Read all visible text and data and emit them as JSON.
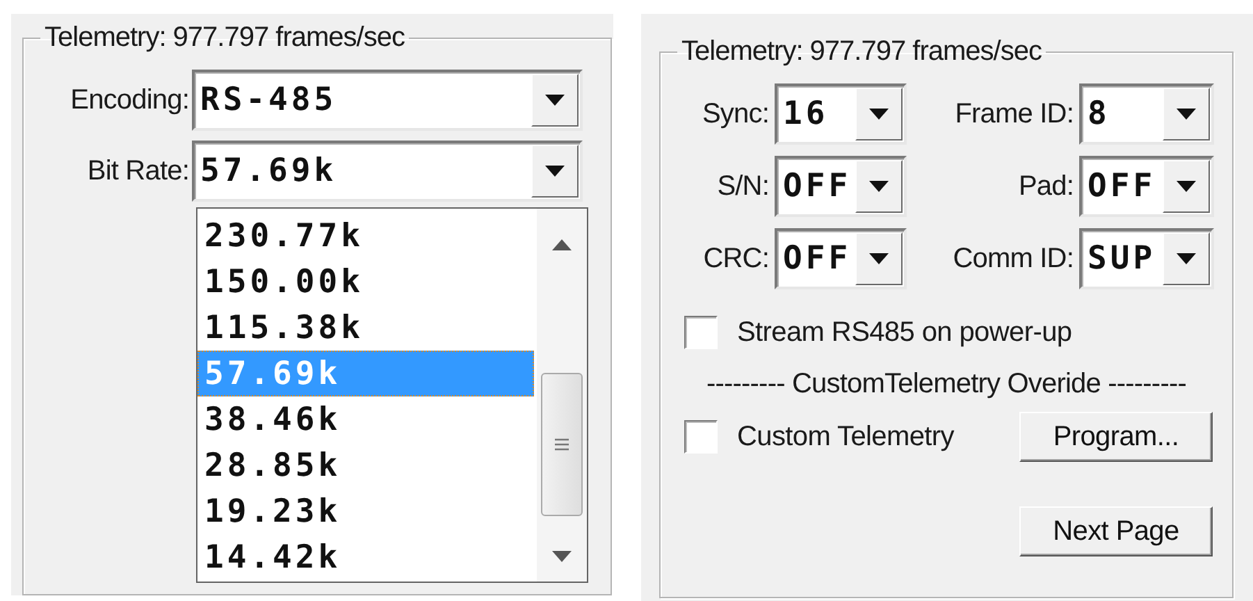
{
  "left_panel": {
    "group_title": "Telemetry: 977.797 frames/sec",
    "fields": [
      {
        "label": "Encoding:",
        "value": "RS-485"
      },
      {
        "label": "Bit Rate:",
        "value": "57.69k"
      }
    ],
    "dropdown": {
      "items": [
        {
          "label": "230.77k",
          "selected": false
        },
        {
          "label": "150.00k",
          "selected": false
        },
        {
          "label": "115.38k",
          "selected": false
        },
        {
          "label": "57.69k",
          "selected": true
        },
        {
          "label": "38.46k",
          "selected": false
        },
        {
          "label": "28.85k",
          "selected": false
        },
        {
          "label": "19.23k",
          "selected": false
        },
        {
          "label": "14.42k",
          "selected": false
        }
      ]
    }
  },
  "right_panel": {
    "group_title": "Telemetry: 977.797 frames/sec",
    "fields": [
      {
        "label": "Sync:",
        "value": "16"
      },
      {
        "label": "Frame ID:",
        "value": "8"
      },
      {
        "label": "S/N:",
        "value": "OFF"
      },
      {
        "label": "Pad:",
        "value": "OFF"
      },
      {
        "label": "CRC:",
        "value": "OFF"
      },
      {
        "label": "Comm ID:",
        "value": "SUP"
      }
    ],
    "stream_checkbox": {
      "label": "Stream RS485 on power-up",
      "checked": false
    },
    "separator": "--------- CustomTelemetry Overide ---------",
    "custom_checkbox": {
      "label": "Custom Telemetry",
      "checked": false
    },
    "program_button": "Program...",
    "next_button": "Next Page"
  }
}
